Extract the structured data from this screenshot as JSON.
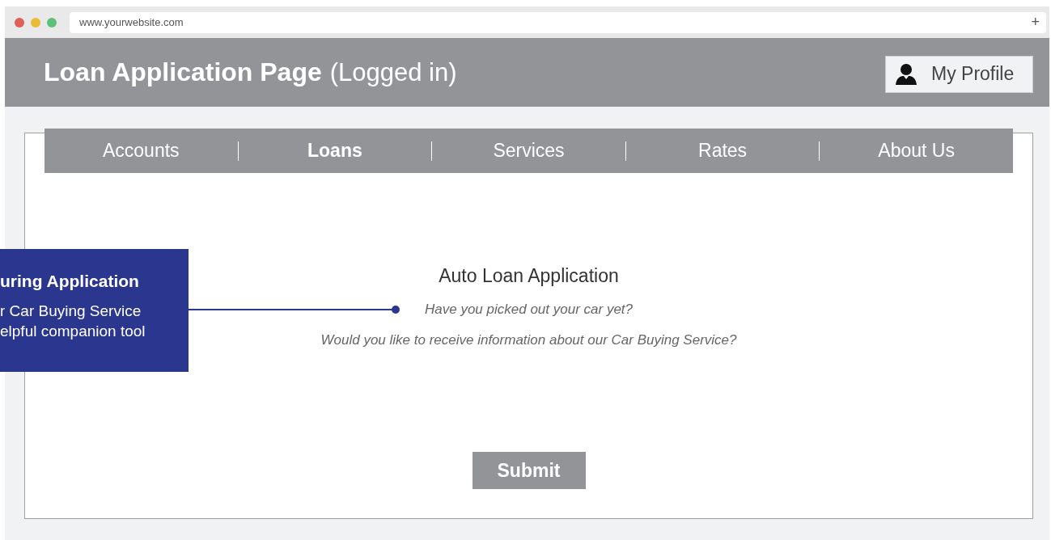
{
  "browser": {
    "url": "www.yourwebsite.com",
    "new_tab": "+"
  },
  "header": {
    "title": "Loan Application Page",
    "subtitle": "(Logged in)",
    "profile_button": "My Profile"
  },
  "nav": [
    {
      "label": "Accounts",
      "selected": false
    },
    {
      "label": "Loans",
      "selected": true
    },
    {
      "label": "Services",
      "selected": false
    },
    {
      "label": "Rates",
      "selected": false
    },
    {
      "label": "About  Us",
      "selected": false
    }
  ],
  "form": {
    "title": "Auto Loan Application",
    "questions": [
      "Have you picked out your car yet?",
      "Would you like to receive information about our Car Buying Service?"
    ],
    "submit": "Submit"
  },
  "callout": {
    "title": "uring Application",
    "lines": [
      "r Car Buying Service",
      "elpful companion tool"
    ]
  }
}
